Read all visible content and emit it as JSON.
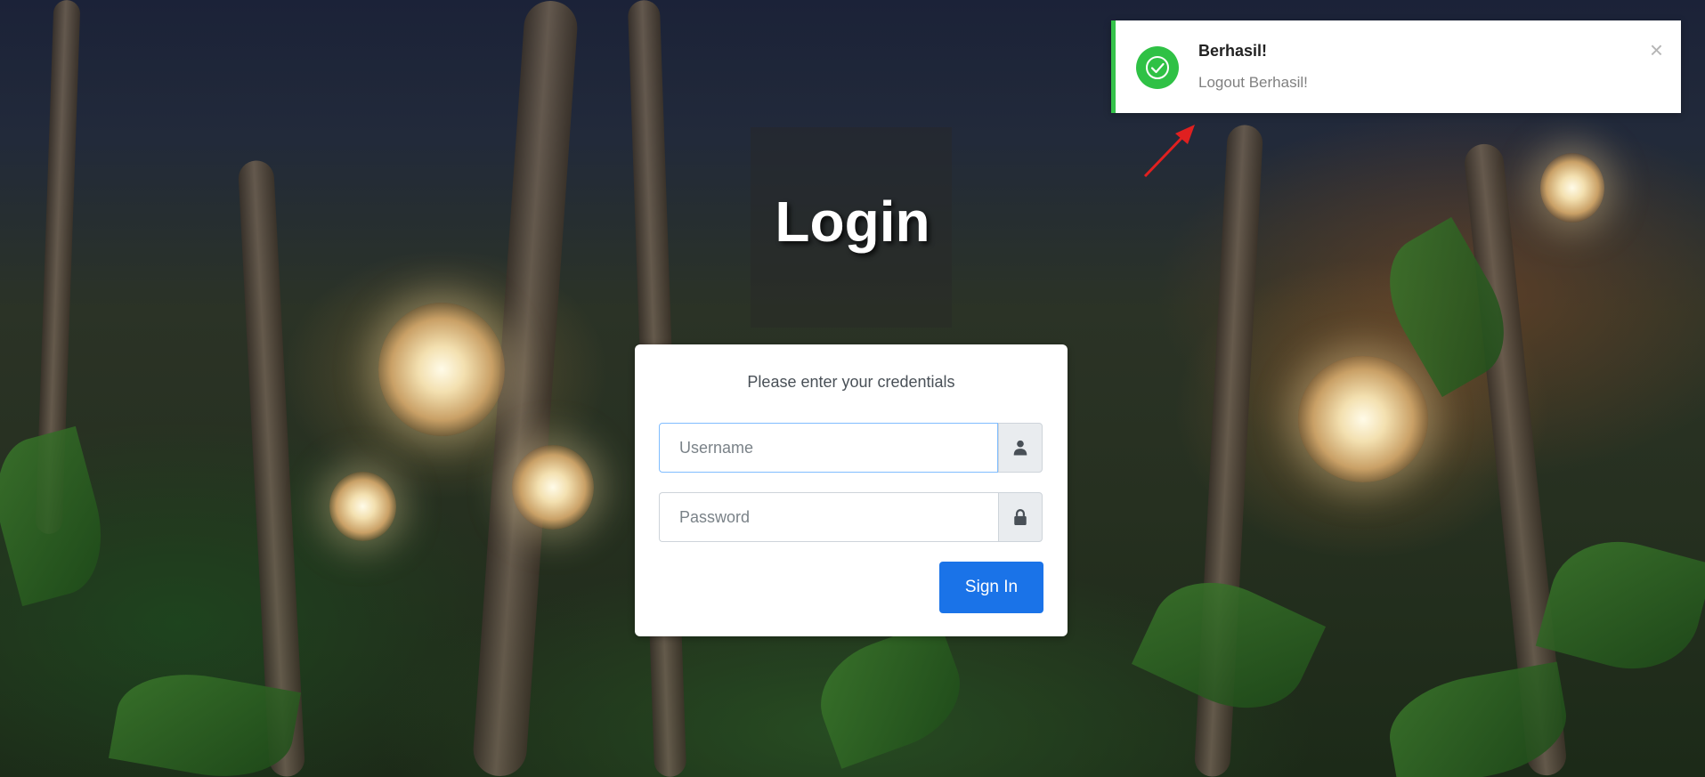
{
  "page": {
    "title": "Login"
  },
  "login": {
    "message": "Please enter your credentials",
    "username_placeholder": "Username",
    "password_placeholder": "Password",
    "username_icon": "user-icon",
    "password_icon": "lock-icon",
    "signin_label": "Sign In",
    "accent_color": "#1a73e8"
  },
  "toast": {
    "title": "Berhasil!",
    "message": "Logout Berhasil!",
    "icon": "check-circle-icon",
    "close_icon": "close-icon",
    "close_glyph": "×",
    "accent_color": "#35c24a"
  }
}
